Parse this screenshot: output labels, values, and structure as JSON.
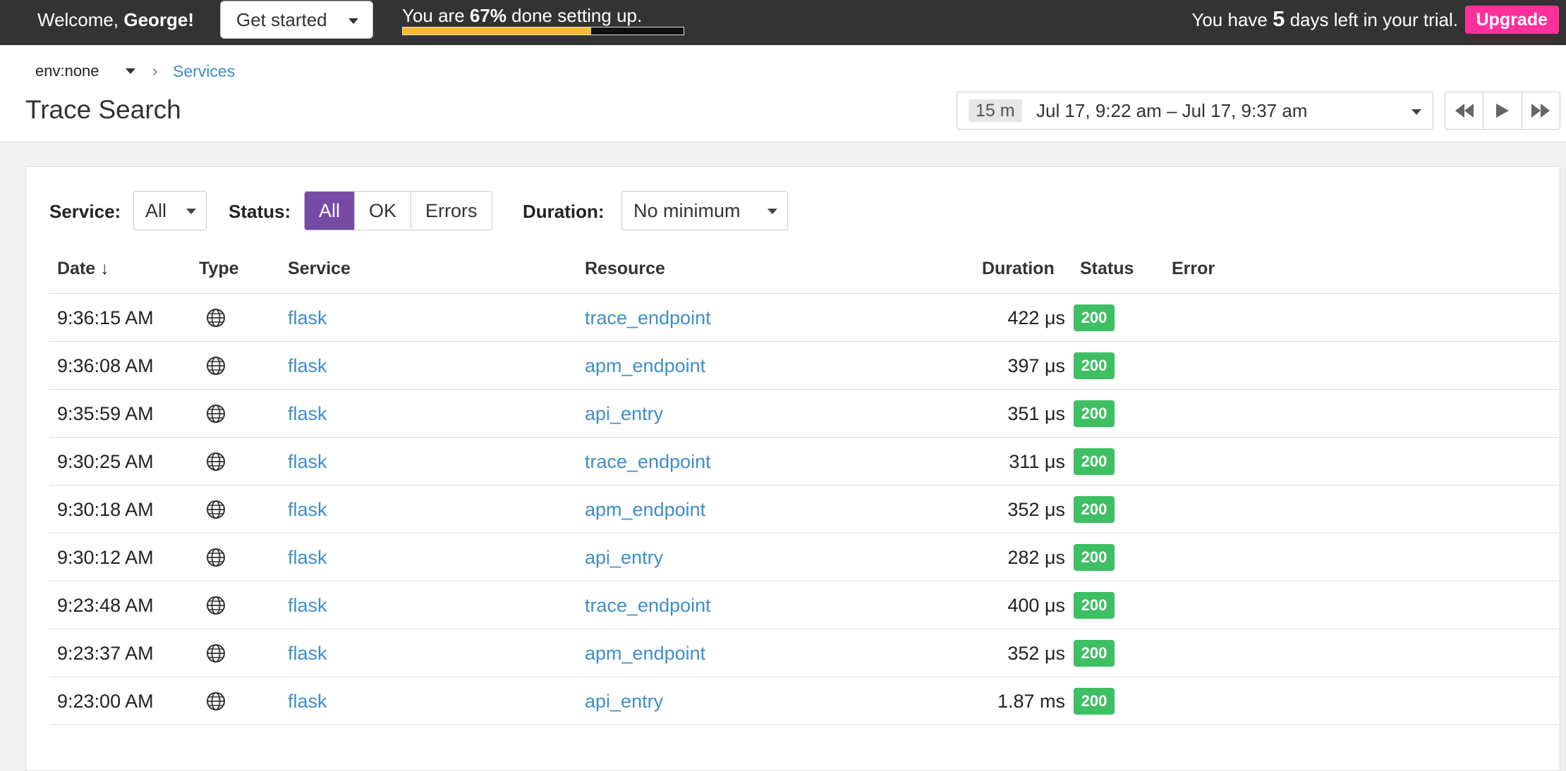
{
  "banner": {
    "welcome_prefix": "Welcome, ",
    "welcome_name": "George!",
    "get_started_label": "Get started",
    "setup_prefix": "You are ",
    "setup_percent": "67%",
    "setup_suffix": " done setting up.",
    "setup_progress": 0.67,
    "trial_prefix": "You have ",
    "trial_days": "5",
    "trial_suffix": " days left in your trial.",
    "upgrade_label": "Upgrade"
  },
  "breadcrumb": {
    "env": "env:none",
    "separator": "›",
    "services_link": "Services"
  },
  "page_title": "Trace Search",
  "timerange": {
    "badge": "15 m",
    "text": "Jul 17, 9:22 am – Jul 17, 9:37 am"
  },
  "filters": {
    "service_label": "Service:",
    "service_value": "All",
    "status_label": "Status:",
    "status_options": [
      "All",
      "OK",
      "Errors"
    ],
    "duration_label": "Duration:",
    "duration_value": "No minimum"
  },
  "table": {
    "headers": {
      "date": "Date ↓",
      "type": "Type",
      "service": "Service",
      "resource": "Resource",
      "duration": "Duration",
      "status": "Status",
      "error": "Error"
    },
    "rows": [
      {
        "date": "9:36:15 AM",
        "service": "flask",
        "resource": "trace_endpoint",
        "duration": "422 μs",
        "status": "200"
      },
      {
        "date": "9:36:08 AM",
        "service": "flask",
        "resource": "apm_endpoint",
        "duration": "397 μs",
        "status": "200"
      },
      {
        "date": "9:35:59 AM",
        "service": "flask",
        "resource": "api_entry",
        "duration": "351 μs",
        "status": "200"
      },
      {
        "date": "9:30:25 AM",
        "service": "flask",
        "resource": "trace_endpoint",
        "duration": "311 μs",
        "status": "200"
      },
      {
        "date": "9:30:18 AM",
        "service": "flask",
        "resource": "apm_endpoint",
        "duration": "352 μs",
        "status": "200"
      },
      {
        "date": "9:30:12 AM",
        "service": "flask",
        "resource": "api_entry",
        "duration": "282 μs",
        "status": "200"
      },
      {
        "date": "9:23:48 AM",
        "service": "flask",
        "resource": "trace_endpoint",
        "duration": "400 μs",
        "status": "200"
      },
      {
        "date": "9:23:37 AM",
        "service": "flask",
        "resource": "apm_endpoint",
        "duration": "352 μs",
        "status": "200"
      },
      {
        "date": "9:23:00 AM",
        "service": "flask",
        "resource": "api_entry",
        "duration": "1.87 ms",
        "status": "200"
      }
    ]
  },
  "colors": {
    "topbar": "#333333",
    "progress_fill": "#f7bb2b",
    "upgrade": "#ff2f9b",
    "link": "#3d8fc9",
    "status_active": "#774aa4",
    "status_ok": "#3ebf63"
  },
  "icons": {
    "type_icon": "globe-icon",
    "rewind": "rewind-icon",
    "play": "play-icon",
    "fast_forward": "fast-forward-icon"
  }
}
